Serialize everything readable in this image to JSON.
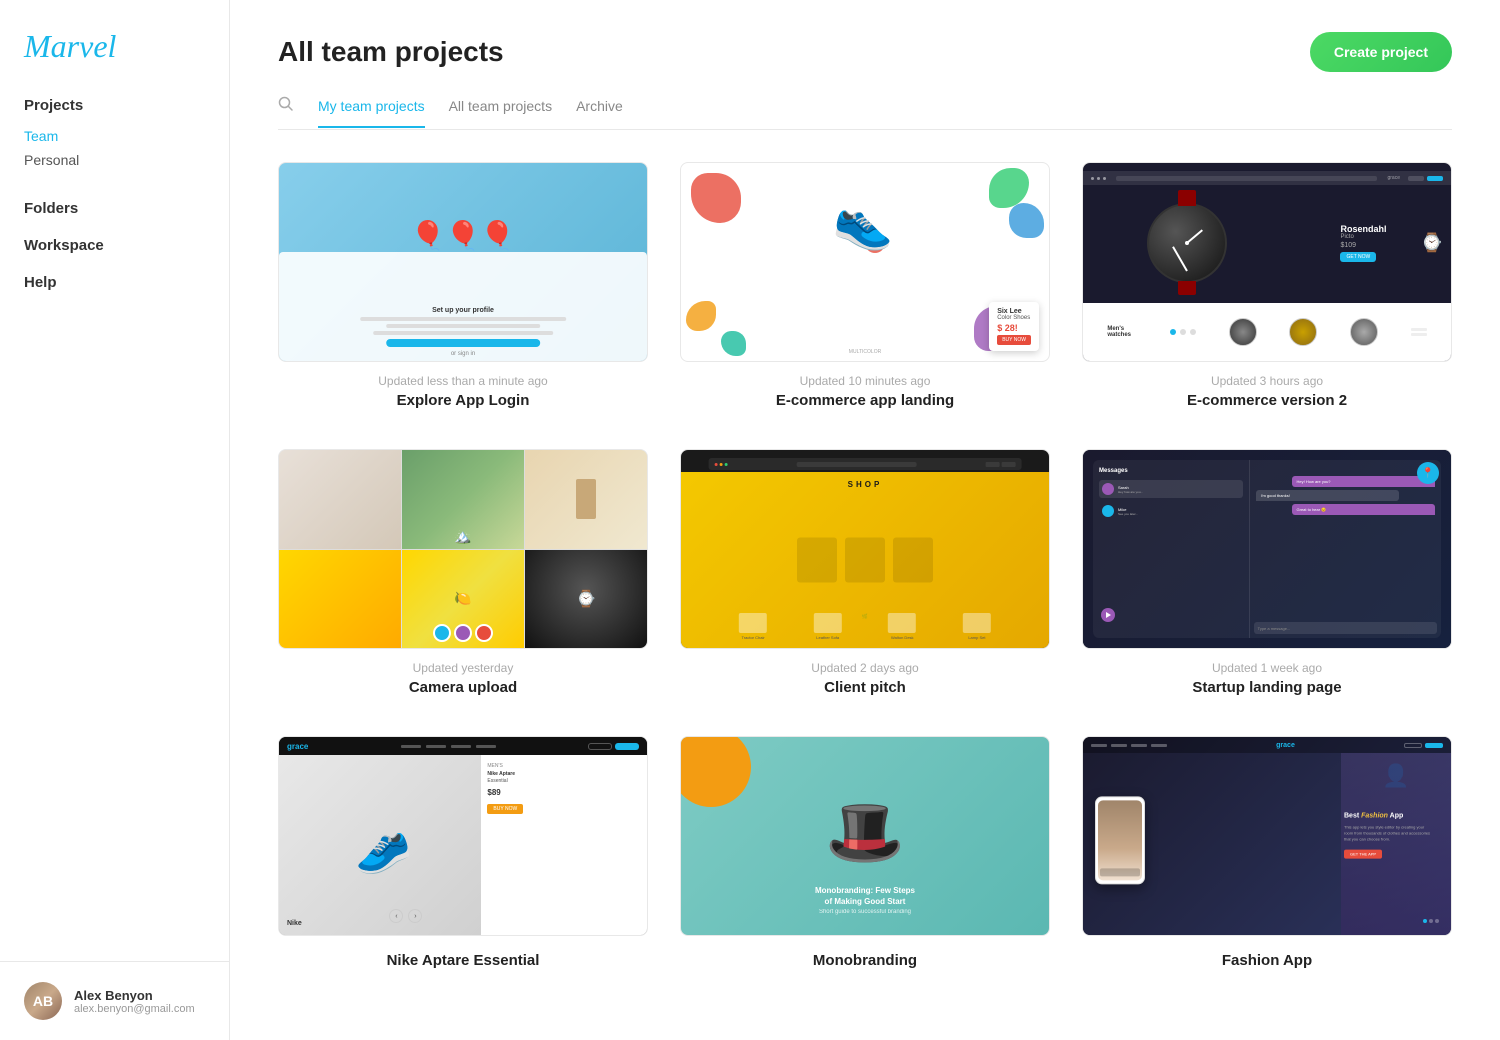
{
  "brand": {
    "logo": "Marvel"
  },
  "sidebar": {
    "sections": [
      {
        "title": "Projects",
        "items": [
          {
            "label": "Team",
            "active": true
          },
          {
            "label": "Personal",
            "active": false
          }
        ]
      }
    ],
    "nav_items": [
      {
        "label": "Folders"
      },
      {
        "label": "Workspace"
      },
      {
        "label": "Help"
      }
    ]
  },
  "user": {
    "name": "Alex Benyon",
    "email": "alex.benyon@gmail.com"
  },
  "header": {
    "title": "All team projects",
    "create_button": "Create project"
  },
  "tabs": [
    {
      "label": "My team projects",
      "active": true
    },
    {
      "label": "All team projects",
      "active": false
    },
    {
      "label": "Archive",
      "active": false
    }
  ],
  "projects": [
    {
      "name": "Explore App Login",
      "updated": "Updated less than a minute ago",
      "type": "explore"
    },
    {
      "name": "E-commerce app landing",
      "updated": "Updated 10 minutes ago",
      "type": "ecomm"
    },
    {
      "name": "E-commerce version 2",
      "updated": "Updated 3 hours ago",
      "type": "watch"
    },
    {
      "name": "Camera upload",
      "updated": "Updated yesterday",
      "type": "camera"
    },
    {
      "name": "Client pitch",
      "updated": "Updated 2 days ago",
      "type": "pitch"
    },
    {
      "name": "Startup landing page",
      "updated": "Updated 1 week ago",
      "type": "startup"
    },
    {
      "name": "Nike Aptare Essential",
      "updated": "",
      "type": "shoes"
    },
    {
      "name": "Monobranding",
      "updated": "",
      "type": "mono"
    },
    {
      "name": "Fashion App",
      "updated": "",
      "type": "fashion"
    }
  ]
}
